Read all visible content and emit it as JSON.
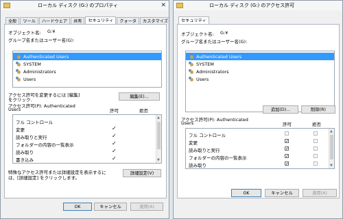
{
  "left_window": {
    "title": "ローカル ディスク (G:) のプロパティ",
    "tabs": [
      {
        "label": "全般",
        "active": false
      },
      {
        "label": "ツール",
        "active": false
      },
      {
        "label": "ハードウェア",
        "active": false
      },
      {
        "label": "共有",
        "active": false
      },
      {
        "label": "セキュリティ",
        "active": true
      },
      {
        "label": "クォータ",
        "active": false
      },
      {
        "label": "カスタマイズ",
        "active": false
      }
    ],
    "object_name_label": "オブジェクト名:",
    "object_name_value": "G:¥",
    "group_label": "グループ名またはユーザー名(G):",
    "users": [
      {
        "name": "Authenticated Users",
        "selected": true
      },
      {
        "name": "SYSTEM",
        "selected": false
      },
      {
        "name": "Administrators",
        "selected": false
      },
      {
        "name": "Users",
        "selected": false
      }
    ],
    "change_perm_text_1": "アクセス許可を変更するには [編集]",
    "change_perm_text_2": "をクリック.",
    "edit_button": "編集(E)...",
    "perm_for_1": "アクセス許可(P): Authenticated",
    "perm_for_2": "Users",
    "allow_header": "許可",
    "deny_header": "拒否",
    "permissions": [
      {
        "name": "フル コントロール",
        "allow": false,
        "deny": false
      },
      {
        "name": "変更",
        "allow": true,
        "deny": false
      },
      {
        "name": "読み取りと実行",
        "allow": true,
        "deny": false
      },
      {
        "name": "フォルダーの内容の一覧表示",
        "allow": true,
        "deny": false
      },
      {
        "name": "読み取り",
        "allow": true,
        "deny": false
      },
      {
        "name": "書き込み",
        "allow": true,
        "deny": false
      }
    ],
    "special_text_1": "特殊なアクセス許可または詳細設定を表示するに",
    "special_text_2": "は、[詳細設定] をクリックします。",
    "advanced_button": "詳細設定(V)",
    "ok_button": "OK",
    "cancel_button": "キャンセル",
    "apply_button": "適用(A)"
  },
  "right_window": {
    "title": "ローカル ディスク (G:) のアクセス許可",
    "tab": "セキュリティ",
    "object_name_label": "オブジェクト名:",
    "object_name_value": "G:¥",
    "group_label": "グループ名またはユーザー名(G):",
    "users": [
      {
        "name": "Authenticated Users",
        "selected": true
      },
      {
        "name": "SYSTEM",
        "selected": false
      },
      {
        "name": "Administrators",
        "selected": false
      },
      {
        "name": "Users",
        "selected": false
      }
    ],
    "add_button": "追加(D)...",
    "remove_button": "削除(R)",
    "perm_for_1": "アクセス許可(P): Authenticated",
    "perm_for_2": "Users",
    "allow_header": "許可",
    "deny_header": "拒否",
    "permissions": [
      {
        "name": "フル コントロール",
        "allow": false,
        "deny": false
      },
      {
        "name": "変更",
        "allow": true,
        "deny": false
      },
      {
        "name": "読み取りと実行",
        "allow": true,
        "deny": false
      },
      {
        "name": "フォルダーの内容の一覧表示",
        "allow": true,
        "deny": false
      },
      {
        "name": "読み取り",
        "allow": true,
        "deny": false
      }
    ],
    "ok_button": "OK",
    "cancel_button": "キャンセル",
    "apply_button": "適用(A)"
  }
}
